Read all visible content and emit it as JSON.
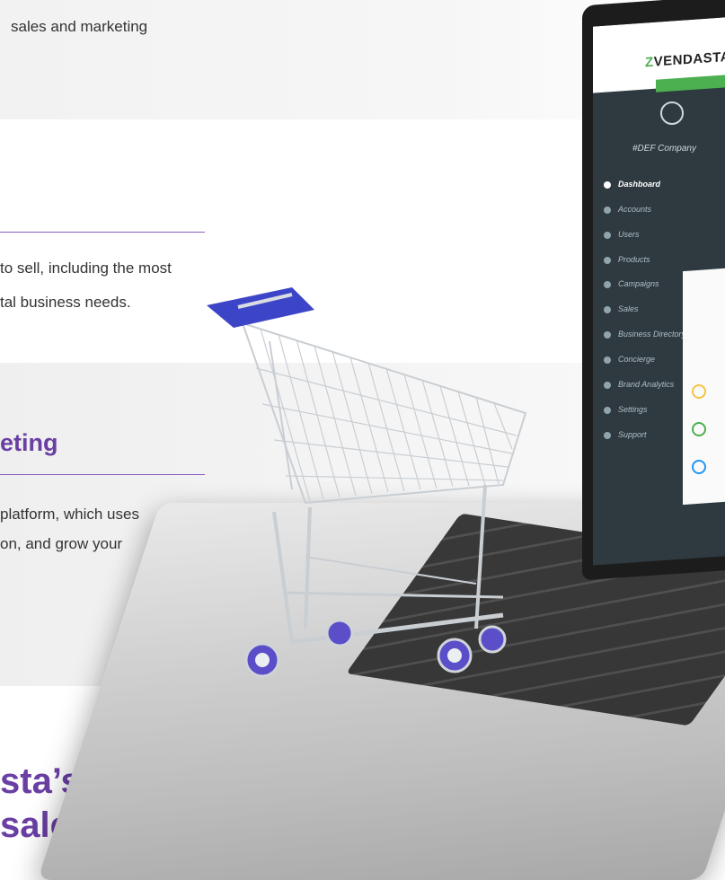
{
  "intro": {
    "line_top": "sales and marketing"
  },
  "section_products": {
    "line1": "to sell, including the most",
    "line2": "tal business needs."
  },
  "section_marketing": {
    "heading": "eting",
    "line1": "platform, which uses",
    "line2": "on, and grow your"
  },
  "bottom": {
    "line1": "sta’s",
    "line2": "sales"
  },
  "screen": {
    "brand": "VENDASTA",
    "company": "#DEF Company",
    "nav": [
      {
        "label": "Dashboard",
        "icon": "dashboard-icon"
      },
      {
        "label": "Accounts",
        "icon": "globe-icon"
      },
      {
        "label": "Users",
        "icon": "user-icon"
      },
      {
        "label": "Products",
        "icon": "grid-icon"
      },
      {
        "label": "Campaigns",
        "icon": "megaphone-icon"
      },
      {
        "label": "Sales",
        "icon": "sales-icon"
      },
      {
        "label": "Business Directory",
        "icon": "pin-icon"
      },
      {
        "label": "Concierge",
        "icon": "concierge-icon"
      },
      {
        "label": "Brand Analytics",
        "icon": "analytics-icon"
      },
      {
        "label": "Settings",
        "icon": "gear-icon"
      },
      {
        "label": "Support",
        "icon": "support-icon"
      }
    ],
    "accent_green": "#4caf50",
    "brand_purple": "#6a3fa3"
  }
}
